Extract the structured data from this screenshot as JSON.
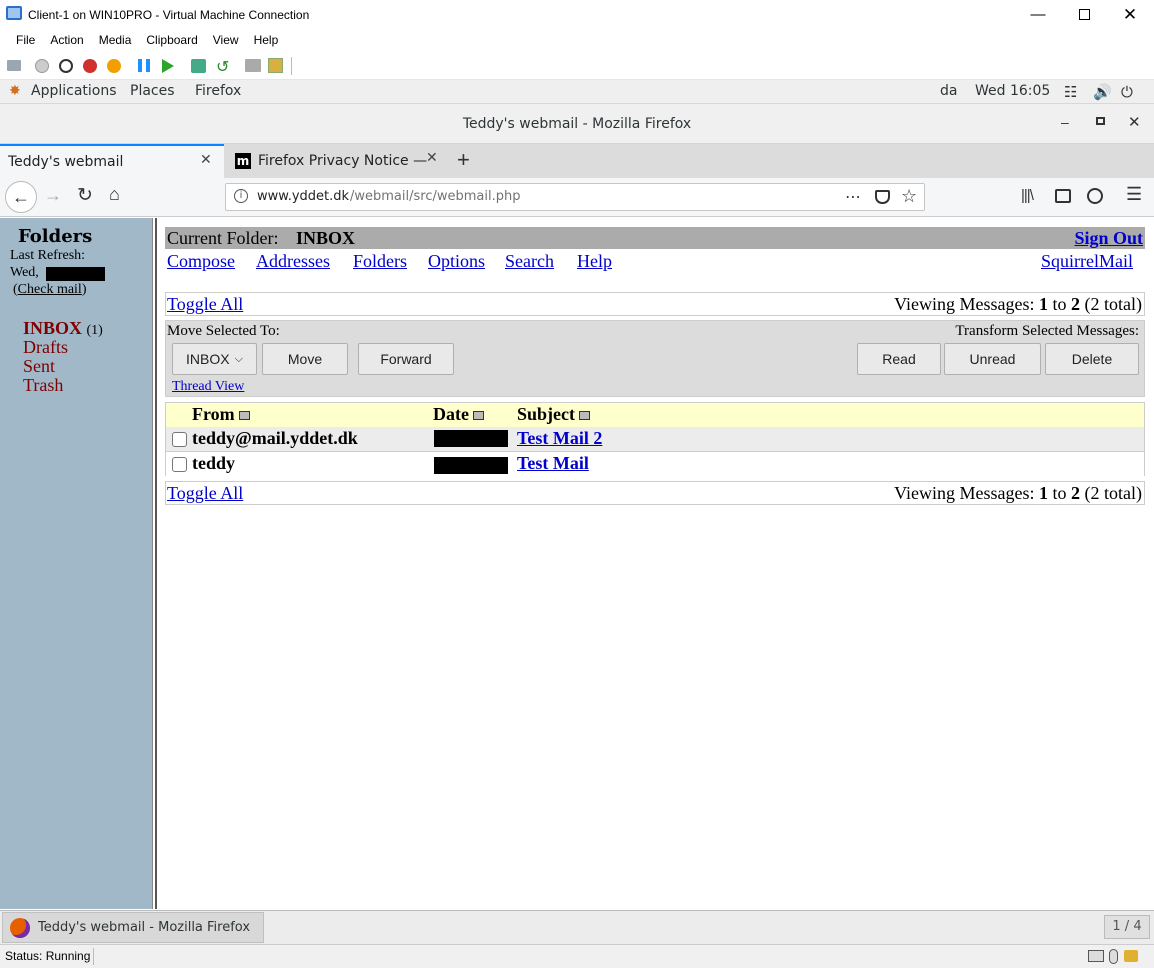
{
  "vm": {
    "title": "Client-1 on WIN10PRO - Virtual Machine Connection",
    "menu": [
      "File",
      "Action",
      "Media",
      "Clipboard",
      "View",
      "Help"
    ],
    "status": "Status: Running"
  },
  "gnome": {
    "applications": "Applications",
    "places": "Places",
    "firefox": "Firefox",
    "lang": "da",
    "clock": "Wed 16:05"
  },
  "browser": {
    "window_title": "Teddy's webmail - Mozilla Firefox",
    "tabs": [
      {
        "label": "Teddy's webmail"
      },
      {
        "label": "Firefox Privacy Notice —",
        "favicon": "m"
      }
    ],
    "url_domain": "www.yddet.dk",
    "url_path": "/webmail/src/webmail.php"
  },
  "sidebar": {
    "heading": "Folders",
    "last_refresh": "Last Refresh:",
    "refresh_day": "Wed,",
    "check_mail_open": "(",
    "check_mail": "Check mail",
    "check_mail_close": ")",
    "folders": [
      {
        "name": "INBOX",
        "count": "(1)"
      },
      {
        "name": "Drafts"
      },
      {
        "name": "Sent"
      },
      {
        "name": "Trash"
      }
    ]
  },
  "main": {
    "current_folder_label": "Current Folder:",
    "current_folder": "INBOX",
    "sign_out": "Sign Out",
    "nav": [
      "Compose",
      "Addresses",
      "Folders",
      "Options",
      "Search",
      "Help"
    ],
    "squirrelmail": "SquirrelMail",
    "toggle_all": "Toggle All",
    "viewing_prefix": "Viewing Messages:",
    "viewing_from": "1",
    "viewing_to_word": "to",
    "viewing_to": "2",
    "viewing_total": "(2 total)",
    "move_selected_to": "Move Selected To:",
    "transform_selected": "Transform Selected Messages:",
    "folder_select": "INBOX",
    "move_btn": "Move",
    "forward_btn": "Forward",
    "read_btn": "Read",
    "unread_btn": "Unread",
    "delete_btn": "Delete",
    "thread_view": "Thread View",
    "columns": {
      "from": "From",
      "date": "Date",
      "subject": "Subject"
    },
    "messages": [
      {
        "from": "teddy@mail.yddet.dk",
        "subject": "Test Mail 2"
      },
      {
        "from": "teddy",
        "subject": "Test Mail"
      }
    ]
  },
  "taskbar": {
    "window": "Teddy's webmail - Mozilla Firefox",
    "workspace": "1 / 4"
  }
}
